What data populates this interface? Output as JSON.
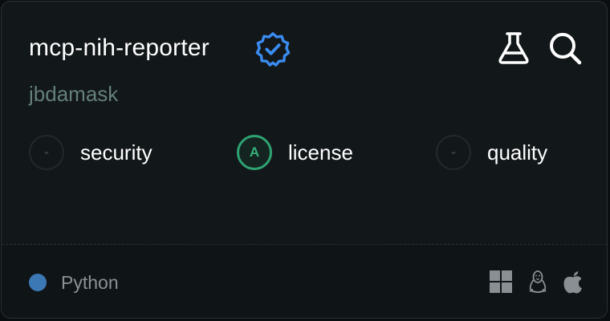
{
  "card": {
    "title": "mcp-nih-reporter",
    "owner": "jbdamask",
    "verified": true
  },
  "header_icons": [
    "verified-badge-icon",
    "flask-icon",
    "search-icon"
  ],
  "scores": [
    {
      "grade": "-",
      "label": "security",
      "state": "empty"
    },
    {
      "grade": "A",
      "label": "license",
      "state": "graded"
    },
    {
      "grade": "-",
      "label": "quality",
      "state": "empty"
    }
  ],
  "footer": {
    "language": "Python",
    "language_color": "#3b78b4",
    "platforms": [
      "windows-icon",
      "linux-icon",
      "apple-icon"
    ]
  },
  "colors": {
    "verified_blue": "#3a8cf0",
    "grade_a_green": "#2ea372",
    "owner_text": "#647f7c"
  }
}
